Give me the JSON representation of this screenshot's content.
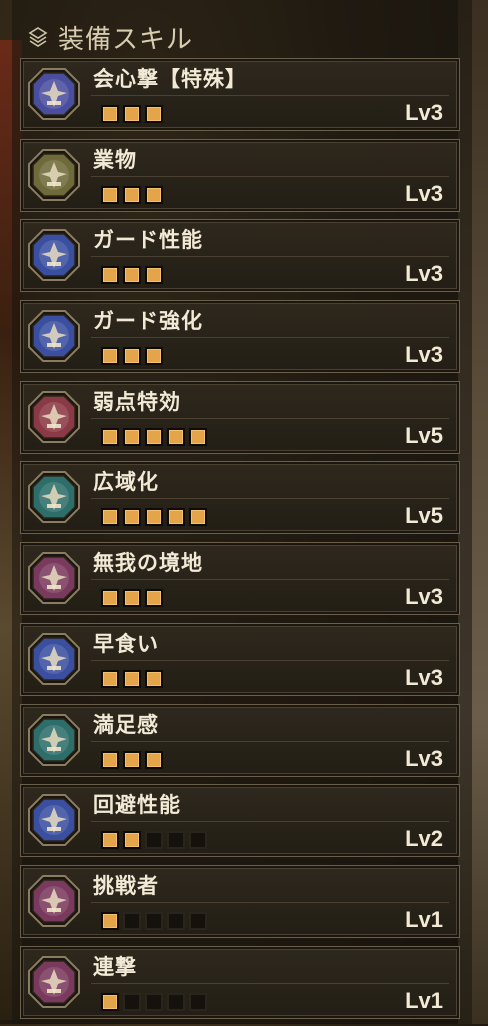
{
  "header": {
    "title": "装備スキル",
    "icon": "layers-icon"
  },
  "colors": {
    "pip_on": "#e4a54a",
    "pip_off": "#15120d",
    "text": "#f2ead6"
  },
  "skills": [
    {
      "name": "会心撃【特殊】",
      "level": "Lv3",
      "filled": 3,
      "total": 3,
      "icon": "critical-element-icon",
      "icon_color": "#4a4e9e"
    },
    {
      "name": "業物",
      "level": "Lv3",
      "filled": 3,
      "total": 3,
      "icon": "sharpness-icon",
      "icon_color": "#6e6a3a"
    },
    {
      "name": "ガード性能",
      "level": "Lv3",
      "filled": 3,
      "total": 3,
      "icon": "guard-icon",
      "icon_color": "#3b4fa0"
    },
    {
      "name": "ガード強化",
      "level": "Lv3",
      "filled": 3,
      "total": 3,
      "icon": "guard-icon",
      "icon_color": "#3b4fa0"
    },
    {
      "name": "弱点特効",
      "level": "Lv5",
      "filled": 5,
      "total": 5,
      "icon": "weakness-exploit-icon",
      "icon_color": "#8a3a44"
    },
    {
      "name": "広域化",
      "level": "Lv5",
      "filled": 5,
      "total": 5,
      "icon": "wide-range-icon",
      "icon_color": "#2e6e6a"
    },
    {
      "name": "無我の境地",
      "level": "Lv3",
      "filled": 3,
      "total": 3,
      "icon": "maximum-might-icon",
      "icon_color": "#7a3a5e"
    },
    {
      "name": "早食い",
      "level": "Lv3",
      "filled": 3,
      "total": 3,
      "icon": "speed-eating-icon",
      "icon_color": "#3b4fa0"
    },
    {
      "name": "満足感",
      "level": "Lv3",
      "filled": 3,
      "total": 3,
      "icon": "free-meal-icon",
      "icon_color": "#2e6e6a"
    },
    {
      "name": "回避性能",
      "level": "Lv2",
      "filled": 2,
      "total": 5,
      "icon": "evade-window-icon",
      "icon_color": "#3b4fa0"
    },
    {
      "name": "挑戦者",
      "level": "Lv1",
      "filled": 1,
      "total": 5,
      "icon": "agitator-icon",
      "icon_color": "#7a3a5e"
    },
    {
      "name": "連撃",
      "level": "Lv1",
      "filled": 1,
      "total": 5,
      "icon": "burst-icon",
      "icon_color": "#7a3a5e"
    }
  ]
}
